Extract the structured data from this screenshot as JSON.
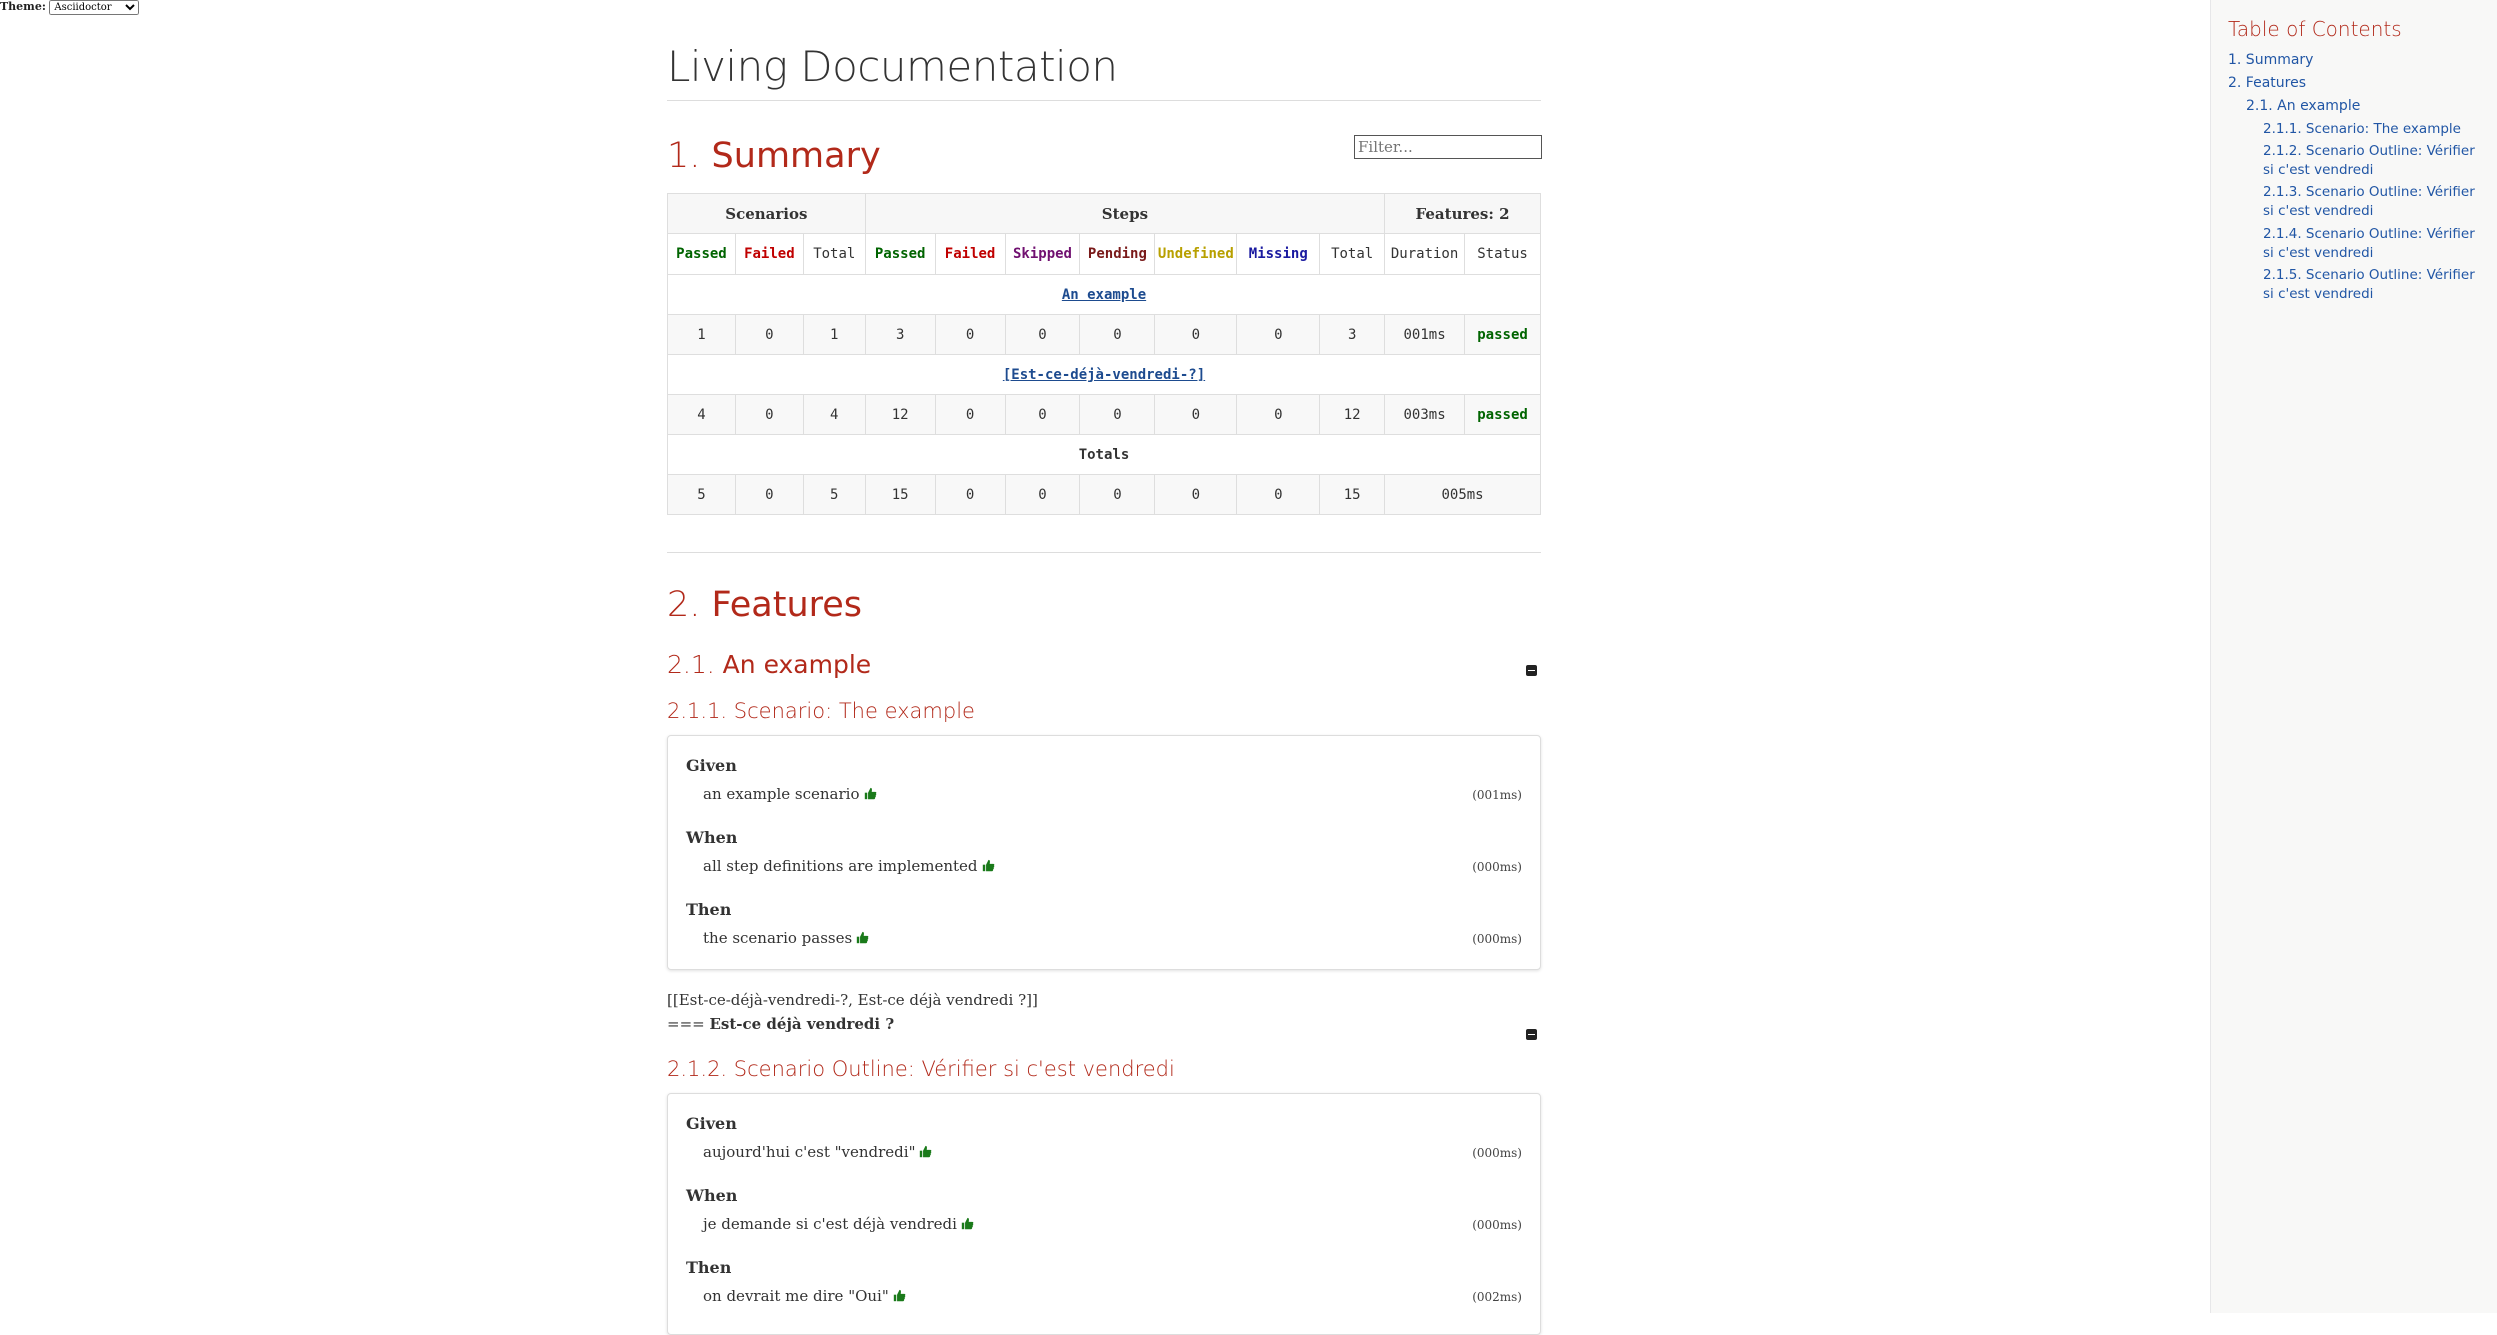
{
  "theme": {
    "label": "Theme:",
    "selected": "Asciidoctor"
  },
  "doc": {
    "title": "Living Documentation"
  },
  "summary": {
    "heading_num": "1.",
    "heading": "Summary",
    "filter_placeholder": "Filter...",
    "header": {
      "scenarios": "Scenarios",
      "steps": "Steps",
      "features": "Features: 2"
    },
    "subheader": [
      "Passed",
      "Failed",
      "Total",
      "Passed",
      "Failed",
      "Skipped",
      "Pending",
      "Undefined",
      "Missing",
      "Total",
      "Duration",
      "Status"
    ],
    "features": [
      {
        "name": "An example",
        "values": [
          "1",
          "0",
          "1",
          "3",
          "0",
          "0",
          "0",
          "0",
          "0",
          "3",
          "001ms",
          "passed"
        ]
      },
      {
        "name": "[Est-ce-déjà-vendredi-?]",
        "values": [
          "4",
          "0",
          "4",
          "12",
          "0",
          "0",
          "0",
          "0",
          "0",
          "12",
          "003ms",
          "passed"
        ]
      }
    ],
    "totals_label": "Totals",
    "totals": [
      "5",
      "0",
      "5",
      "15",
      "0",
      "0",
      "0",
      "0",
      "0",
      "15",
      "005ms"
    ]
  },
  "features_section": {
    "heading_num": "2.",
    "heading": "Features",
    "feature1": {
      "num": "2.1.",
      "title": "An example"
    },
    "scenario1": {
      "num": "2.1.1.",
      "title": "Scenario: The example",
      "steps": [
        {
          "keyword": "Given",
          "text": "an example scenario",
          "duration": "(001ms)"
        },
        {
          "keyword": "When",
          "text": "all step definitions are implemented",
          "duration": "(000ms)"
        },
        {
          "keyword": "Then",
          "text": "the scenario passes",
          "duration": "(000ms)"
        }
      ]
    },
    "raw_anchor": "[[Est-ce-déjà-vendredi-?, Est-ce déjà vendredi ?]]",
    "raw_heading_prefix": "===",
    "raw_heading_bold": "Est-ce déjà vendredi ?",
    "scenario2": {
      "num": "2.1.2.",
      "title": "Scenario Outline: Vérifier si c'est vendredi",
      "steps": [
        {
          "keyword": "Given",
          "text": "aujourd'hui c'est \"vendredi\"",
          "duration": "(000ms)"
        },
        {
          "keyword": "When",
          "text": "je demande si c'est déjà vendredi",
          "duration": "(000ms)"
        },
        {
          "keyword": "Then",
          "text": "on devrait me dire \"Oui\"",
          "duration": "(002ms)"
        }
      ]
    }
  },
  "toc": {
    "title": "Table of Contents",
    "items": [
      "1. Summary",
      "2. Features",
      "2.1. An example",
      "2.1.1. Scenario: The example",
      "2.1.2. Scenario Outline: Vérifier si c'est vendredi",
      "2.1.3. Scenario Outline: Vérifier si c'est vendredi",
      "2.1.4. Scenario Outline: Vérifier si c'est vendredi",
      "2.1.5. Scenario Outline: Vérifier si c'est vendredi"
    ]
  },
  "colors": {
    "heading": "#b2291a",
    "link": "#2156a5",
    "passed": "#006400",
    "failed": "#c00000",
    "skipped": "#701070",
    "pending": "#7a1a1a",
    "undefined": "#b8a000",
    "missing": "#1a1aa0"
  },
  "icons": {
    "step_status": "thumbs-up-icon",
    "collapse": "minus-square-icon"
  }
}
